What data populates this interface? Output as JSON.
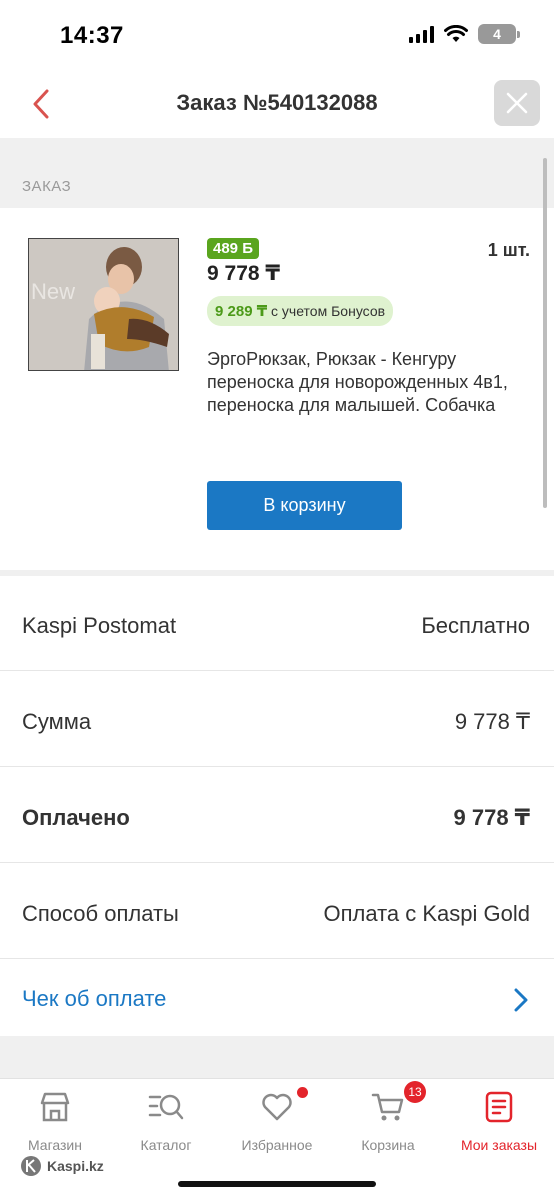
{
  "status_bar": {
    "time": "14:37",
    "battery": "4"
  },
  "header": {
    "title": "Заказ №540132088"
  },
  "order_section": {
    "label": "ЗАКАЗ"
  },
  "product": {
    "bonus_badge": "489 Б",
    "price": "9 778 ₸",
    "quantity": "1 шт.",
    "bonus_price_value": "9 289 ₸",
    "bonus_price_suffix": "с учетом Бонусов",
    "name": "ЭргоРюкзак, Рюкзак - Кенгуру переноска для новорожденных 4в1, переноска для малышей. Собачка",
    "cart_button": "В корзину"
  },
  "details": {
    "delivery_label": "Kaspi Postomat",
    "delivery_value": "Бесплатно",
    "sum_label": "Сумма",
    "sum_value": "9 778 ₸",
    "paid_label": "Оплачено",
    "paid_value": "9 778 ₸",
    "payment_label": "Способ оплаты",
    "payment_value": "Оплата с Kaspi Gold",
    "receipt_link": "Чек об оплате"
  },
  "tabs": [
    {
      "label": "Магазин",
      "icon": "store-icon"
    },
    {
      "label": "Каталог",
      "icon": "catalog-search-icon"
    },
    {
      "label": "Избранное",
      "icon": "heart-icon"
    },
    {
      "label": "Корзина",
      "icon": "cart-icon",
      "badge": "13"
    },
    {
      "label": "Мои заказы",
      "icon": "orders-icon"
    }
  ],
  "watermark": "Kaspi.kz",
  "colors": {
    "accent_red": "#e3242b",
    "link_blue": "#1b78c4",
    "bonus_green": "#5aa51e"
  }
}
